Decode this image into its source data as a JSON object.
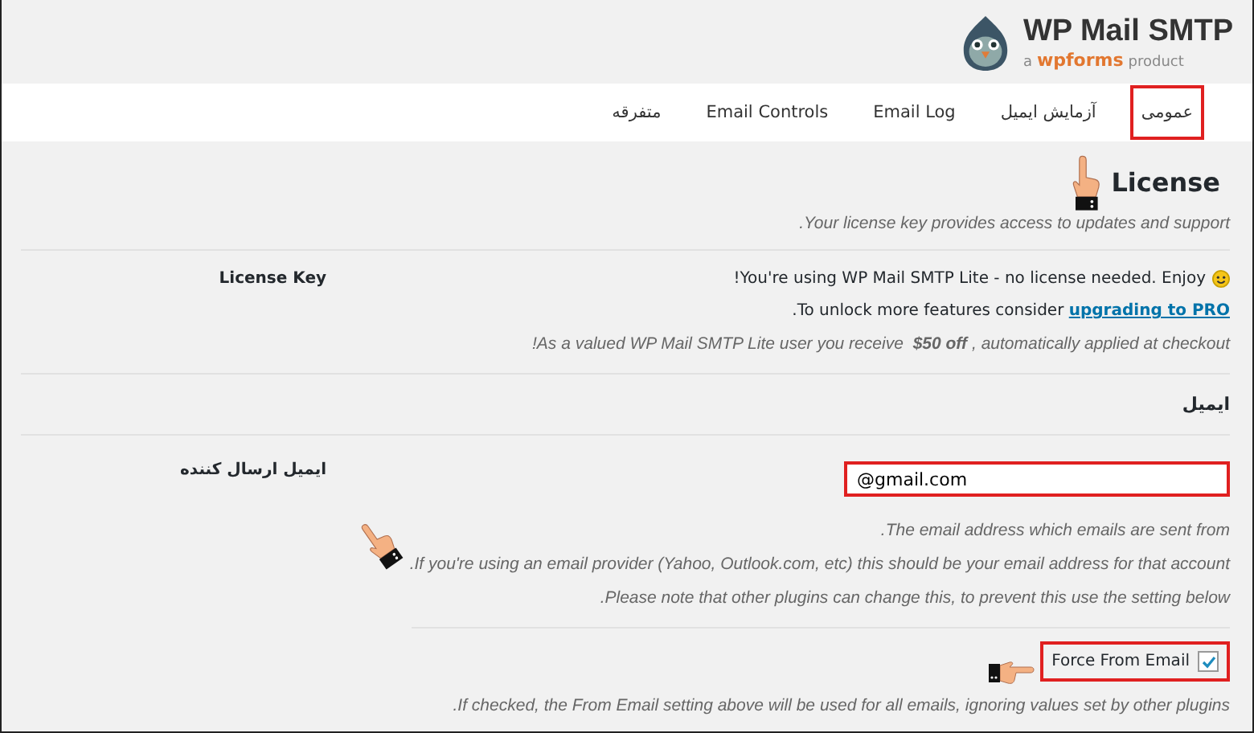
{
  "logo": {
    "title": "WP Mail SMTP",
    "tagline_prefix": "a",
    "brand": "wpforms",
    "tagline_suffix": "product"
  },
  "tabs": [
    {
      "label": "عمومی",
      "selected": true
    },
    {
      "label": "آزمایش ایمیل",
      "selected": false
    },
    {
      "label": "Email Log",
      "selected": false
    },
    {
      "label": "Email Controls",
      "selected": false
    },
    {
      "label": "متفرقه",
      "selected": false
    }
  ],
  "license_section": {
    "title": "License",
    "description": "Your license key provides access to updates and support."
  },
  "license_key": {
    "label": "License Key",
    "status": "You're using WP Mail SMTP Lite - no license needed. Enjoy!",
    "upgrade_text": "To unlock more features consider ",
    "upgrade_link": "upgrading to PRO",
    "upgrade_end": ".",
    "discount": "!As a valued WP Mail SMTP Lite user you receive **$50 off**, automatically applied at checkout"
  },
  "email_section": {
    "title": "ایمیل"
  },
  "from_email": {
    "label": "ایمیل ارسال کننده",
    "value": "@gmail.com",
    "highlighted": true,
    "help": [
      "The email address which emails are sent from.",
      "If you're using an email provider (Yahoo, Outlook.com, etc) this should be your email address for that account.",
      "Please note that other plugins can change this, to prevent this use the setting below."
    ]
  },
  "force_from_email": {
    "label": "Force From Email",
    "checked": true,
    "highlighted": true,
    "help": "If checked, the From Email setting above will be used for all emails, ignoring values set by other plugins."
  }
}
